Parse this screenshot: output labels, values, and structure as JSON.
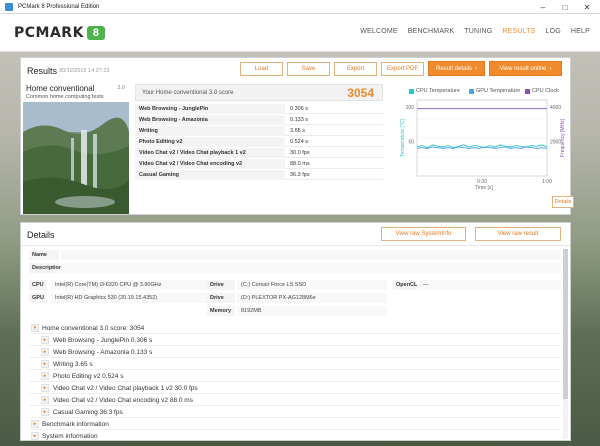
{
  "window": {
    "title": "PCMark 8 Professional Edition",
    "minimize": "–",
    "maximize": "□",
    "close": "✕"
  },
  "logo": {
    "text": "PCMARK",
    "number": "8"
  },
  "nav": [
    "WELCOME",
    "BENCHMARK",
    "TUNING",
    "RESULTS",
    "LOG",
    "HELP"
  ],
  "results": {
    "title": "Results",
    "timestamp": "30/12/2015 14:27:23",
    "buttons": {
      "load": "Load",
      "save": "Save",
      "export": "Export",
      "export_pdf": "Export PDF",
      "result_details": "Result details",
      "view_online": "View result online"
    },
    "card": {
      "title": "Home conventional",
      "version": "3.0",
      "subtitle": "Common home computing tests"
    },
    "score": {
      "label": "Your Home conventional 3.0 score",
      "value": "3054"
    },
    "rows": [
      {
        "name": "Web Browsing - JunglePin",
        "value": "0.306 s"
      },
      {
        "name": "Web Browsing - Amazonia",
        "value": "0.133 s"
      },
      {
        "name": "Writing",
        "value": "3.65 s"
      },
      {
        "name": "Photo Editing v2",
        "value": "0.524 s"
      },
      {
        "name": "Video Chat v2 / Video Chat playback 1 v2",
        "value": "30.0 fps"
      },
      {
        "name": "Video Chat v2 / Video Chat encoding v2",
        "value": "88.0 ms"
      },
      {
        "name": "Casual Gaming",
        "value": "36.3 fps"
      }
    ],
    "details_button": "Details"
  },
  "chart_data": {
    "type": "line",
    "legend": [
      "CPU Temperature",
      "GPU Temperature",
      "CPU Clock"
    ],
    "colors": {
      "cpu_temp": "#28c7cf",
      "gpu_temp": "#4aa3df",
      "cpu_clock": "#8b4fb3"
    },
    "xlabel": "Time [s]",
    "x_ticks": [
      "0:30",
      "1:00"
    ],
    "ylabel_left": "Temperature [°C]",
    "y_left_ticks": [
      "50",
      "100"
    ],
    "ylabel_right": "Frequency [MHz]",
    "y_right_ticks": [
      "2000",
      "4000"
    ],
    "series": [
      {
        "name": "CPU Temperature",
        "values": [
          42,
          44,
          41,
          45,
          43,
          42,
          44,
          41,
          43,
          45,
          42,
          44,
          43,
          41,
          44,
          42,
          45,
          43,
          42,
          44,
          43,
          42,
          44,
          43,
          45,
          42
        ]
      },
      {
        "name": "GPU Temperature",
        "values": [
          40,
          41,
          40,
          42,
          41,
          40,
          41,
          40,
          42,
          41,
          40,
          41,
          40,
          42,
          41,
          40,
          41,
          42,
          40,
          41,
          40,
          42,
          41,
          40,
          41,
          40
        ]
      },
      {
        "name": "CPU Clock",
        "values": [
          3900,
          3900,
          3900,
          3900,
          3900,
          3900,
          3900,
          3900,
          3900,
          3900,
          3900,
          3900,
          3900,
          3900,
          3900,
          3900,
          3900,
          3900,
          3900,
          3900,
          3900,
          3900,
          3900,
          3900,
          3900,
          3900
        ]
      }
    ],
    "y_left_range": [
      0,
      110
    ],
    "y_right_range": [
      0,
      4400
    ]
  },
  "details": {
    "title": "Details",
    "view_raw_sysinfo": "View raw SystemInfo",
    "view_raw_result": "View raw result",
    "name_label": "Name",
    "description_label": "Description",
    "hardware": {
      "cpu_label": "CPU",
      "cpu_value": "Intel(R) Core(TM) i3-6320 CPU @ 3.90GHz",
      "gpu_label": "GPU",
      "gpu_value": "Intel(R) HD Graphics 530 (20.19.15.4352)",
      "drive_label": "Drive",
      "drive1_value": "(C:) Corsair Force LS SSD",
      "drive2_value": "(D:) PLEXTOR PX-AG128M6e",
      "memory_label": "Memory",
      "memory_value": "8192MB",
      "opencl_label": "OpenCL",
      "opencl_value": "—"
    },
    "tree": [
      {
        "label": "Home conventional 3.0 score: 3054",
        "level": 0,
        "open": true
      },
      {
        "label": "Web Browsing - JunglePin 0.306 s",
        "level": 1
      },
      {
        "label": "Web Browsing - Amazonia 0.133 s",
        "level": 1
      },
      {
        "label": "Writing 3.65 s",
        "level": 1
      },
      {
        "label": "Photo Editing v2 0.524 s",
        "level": 1
      },
      {
        "label": "Video Chat v2 / Video Chat playback 1 v2 30.0 fps",
        "level": 1
      },
      {
        "label": "Video Chat v2 / Video Chat encoding v2 88.0 ms",
        "level": 1
      },
      {
        "label": "Casual Gaming 36.3 fps",
        "level": 1
      },
      {
        "label": "Benchmark information",
        "level": 0
      },
      {
        "label": "System information",
        "level": 0
      }
    ]
  }
}
